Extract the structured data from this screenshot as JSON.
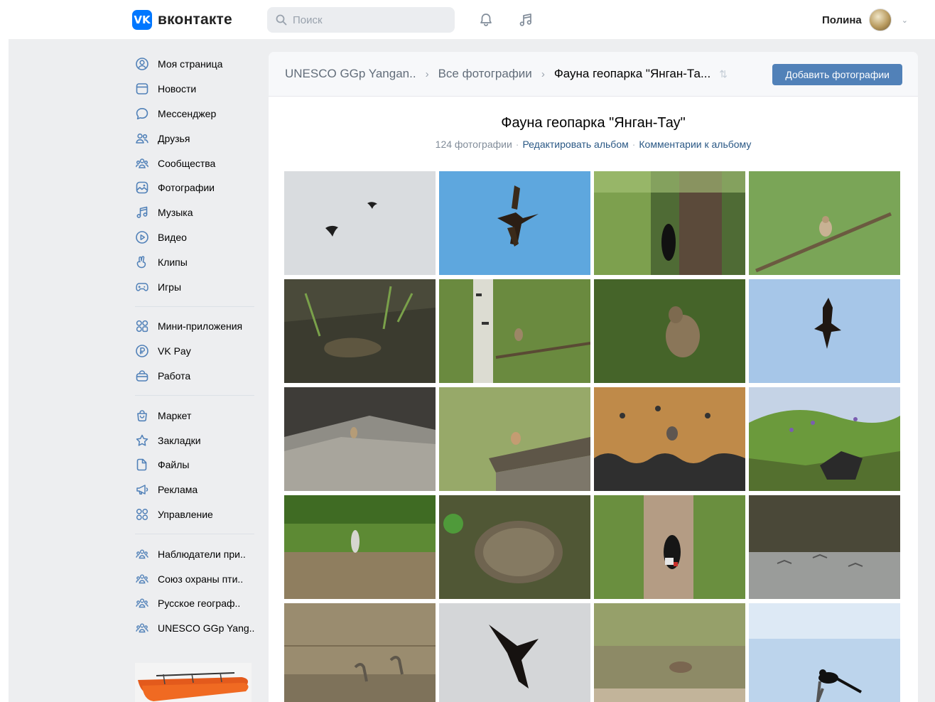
{
  "header": {
    "logo_mark": "VK",
    "logo_text": "вконтакте",
    "search_placeholder": "Поиск",
    "user_name": "Полина"
  },
  "sidebar": {
    "group1": [
      {
        "label": "Моя страница",
        "icon": "user-circle-icon"
      },
      {
        "label": "Новости",
        "icon": "newspaper-icon"
      },
      {
        "label": "Мессенджер",
        "icon": "message-bubble-icon"
      },
      {
        "label": "Друзья",
        "icon": "friends-icon"
      },
      {
        "label": "Сообщества",
        "icon": "communities-icon"
      },
      {
        "label": "Фотографии",
        "icon": "photo-icon"
      },
      {
        "label": "Музыка",
        "icon": "music-note-icon"
      },
      {
        "label": "Видео",
        "icon": "play-circle-icon"
      },
      {
        "label": "Клипы",
        "icon": "clips-hand-icon"
      },
      {
        "label": "Игры",
        "icon": "gamepad-icon"
      }
    ],
    "group2": [
      {
        "label": "Мини-приложения",
        "icon": "mini-apps-icon"
      },
      {
        "label": "VK Pay",
        "icon": "vk-pay-icon"
      },
      {
        "label": "Работа",
        "icon": "briefcase-icon"
      }
    ],
    "group3": [
      {
        "label": "Маркет",
        "icon": "shopping-bag-icon"
      },
      {
        "label": "Закладки",
        "icon": "star-icon"
      },
      {
        "label": "Файлы",
        "icon": "file-icon"
      },
      {
        "label": "Реклама",
        "icon": "megaphone-icon"
      },
      {
        "label": "Управление",
        "icon": "management-grid-icon"
      }
    ],
    "group4": [
      {
        "label": "Наблюдатели при..",
        "icon": "group-icon"
      },
      {
        "label": "Союз охраны пти..",
        "icon": "group-icon"
      },
      {
        "label": "Русское географ..",
        "icon": "group-icon"
      },
      {
        "label": "UNESCO GGp Yang..",
        "icon": "group-icon"
      }
    ]
  },
  "breadcrumb": {
    "items": [
      "UNESCO GGp Yangan..",
      "Все фотографии",
      "Фауна геопарка \"Янган-Та..."
    ],
    "sort_icon": "sort-arrows-icon"
  },
  "toolbar": {
    "add_photos_label": "Добавить фотографии"
  },
  "album": {
    "title": "Фауна геопарка \"Янган-Тау\"",
    "count": "124 фотографии",
    "edit_link": "Редактировать альбом",
    "comments_link": "Комментарии к альбому"
  },
  "colors": {
    "accent": "#5181b8",
    "vk_blue": "#0077ff",
    "link": "#2a5885",
    "page_bg": "#edeef0"
  },
  "photos": [
    {
      "subject": "two-crows-grey-sky"
    },
    {
      "subject": "kite-blue-sky"
    },
    {
      "subject": "woodpecker-on-trunk"
    },
    {
      "subject": "small-bird-on-branch"
    },
    {
      "subject": "frog-in-mud"
    },
    {
      "subject": "bird-in-birch-forest"
    },
    {
      "subject": "hare-in-grass"
    },
    {
      "subject": "eagle-blue-sky"
    },
    {
      "subject": "bird-on-rocks"
    },
    {
      "subject": "bird-on-wooden-roof"
    },
    {
      "subject": "bird-on-slate-roof"
    },
    {
      "subject": "flowers-meadow-rocks"
    },
    {
      "subject": "heron-in-grass"
    },
    {
      "subject": "hedgehog"
    },
    {
      "subject": "spotted-woodpecker"
    },
    {
      "subject": "birds-over-water"
    },
    {
      "subject": "cranes-in-field"
    },
    {
      "subject": "raptor-flying"
    },
    {
      "subject": "bird-on-ground"
    },
    {
      "subject": "magpie-sky"
    }
  ]
}
